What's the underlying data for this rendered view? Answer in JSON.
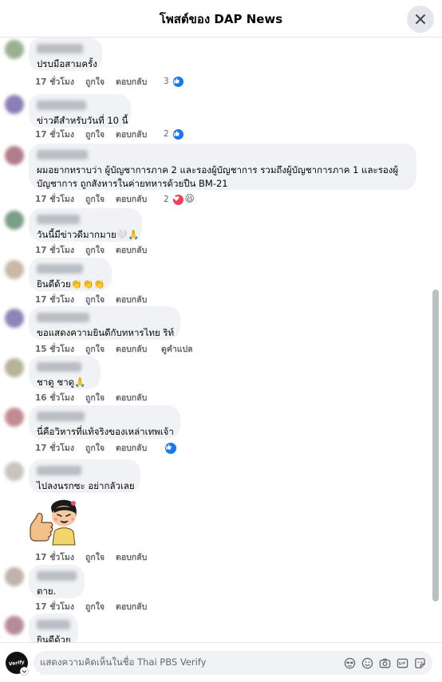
{
  "header": {
    "title": "โพสต์ของ DAP News"
  },
  "labels": {
    "like": "ถูกใจ",
    "reply": "ตอบกลับ",
    "translate": "ดูคำแปล"
  },
  "comments": [
    {
      "text": "ปรบมือสามครั้ง",
      "time": "17 ชั่วโมง",
      "reaction_count": "3",
      "reactions": [
        "like"
      ]
    },
    {
      "text": "ข่าวดีสำหรับวันที่ 10 นี้",
      "time": "17 ชั่วโมง",
      "reaction_count": "2",
      "reactions": [
        "like"
      ]
    },
    {
      "text": "ผมอยากทราบว่า ผู้บัญชาการภาค 2 และรองผู้บัญชาการ รวมถึงผู้บัญชาการภาค 1 และรองผู้บัญชาการ ถูกสังหารในค่ายทหารด้วยปืน BM-21",
      "time": "17 ชั่วโมง",
      "reaction_count": "2",
      "reactions": [
        "love",
        "haha"
      ]
    },
    {
      "text": "วันนี้มีข่าวดีมากมาย🤍🙏",
      "time": "17 ชั่วโมง"
    },
    {
      "text": "ยินดีด้วย👏👏👏",
      "time": "17 ชั่วโมง"
    },
    {
      "text": "ขอแสดงความยินดีกับทหารไทย ริท์",
      "time": "15 ชั่วโมง",
      "show_translate": true
    },
    {
      "text": "ชาดู ชาดู🙏",
      "time": "16 ชั่วโมง"
    },
    {
      "text": "นี่คือวิหารที่แท้จริงของเหล่าเทพเจ้า",
      "time": "17 ชั่วโมง",
      "reactions": [
        "like"
      ]
    },
    {
      "text": "ไปลงนรกซะ อย่ากลัวเลย",
      "time": "17 ชั่วโมง",
      "sticker": "thumbs-up-girl-sticker"
    },
    {
      "text": "ตาย.",
      "time": "17 ชั่วโมง"
    },
    {
      "text": "ยินดีด้วย",
      "time": ""
    }
  ],
  "composer": {
    "placeholder": "แสดงความคิดเห็นในชื่อ Thai PBS Verify",
    "avatar_text": "Verify"
  },
  "icons": [
    "close-icon",
    "like-icon",
    "love-icon",
    "haha-icon",
    "avatar-icon",
    "sticker-icon",
    "emoji-icon",
    "camera-icon",
    "gif-icon",
    "sticker-box-icon"
  ],
  "colors": {
    "like_blue": "#1877f2",
    "love_red": "#f33e58",
    "bubble": "#f0f2f5",
    "meta_gray": "#65676b"
  }
}
